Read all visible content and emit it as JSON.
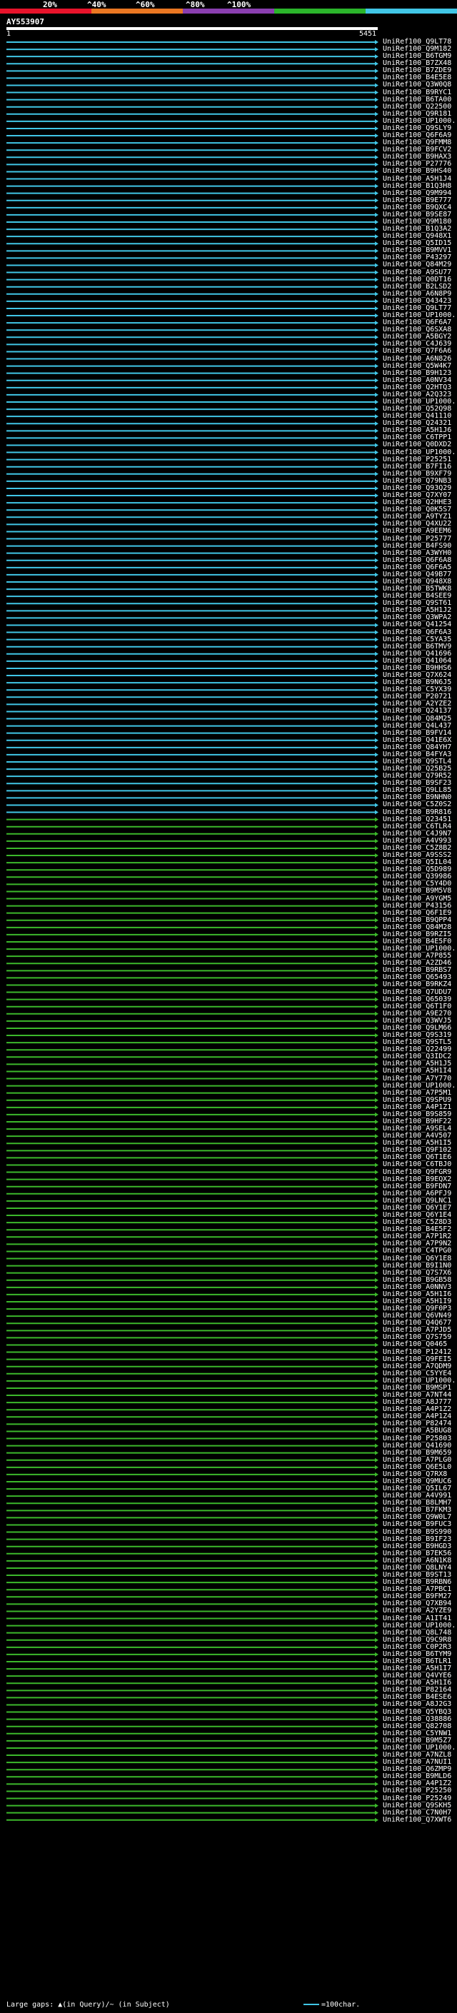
{
  "scale": {
    "labels": [
      "20%",
      "^40%",
      "^60%",
      "^80%",
      "^100%"
    ],
    "colors": [
      "#e8132b",
      "#ea7722",
      "#8a3fb0",
      "#2bb52b",
      "#41c6e6"
    ]
  },
  "query": {
    "id": "AY553907",
    "start": "1",
    "end": "5451"
  },
  "colors": {
    "high": "#41c6e6",
    "mid": "#3cb82b"
  },
  "hits": [
    "UniRef100_Q9LT78",
    "UniRef100_Q9M182",
    "UniRef100_B6TGM9",
    "UniRef100_B7ZX48",
    "UniRef100_B7ZDE9",
    "UniRef100_B4E5E8",
    "UniRef100_Q3W0Q8",
    "UniRef100_B9RYC1",
    "UniRef100_B6TA00",
    "UniRef100_Q22500",
    "UniRef100_Q9R181",
    "UniRef100_UP1000...",
    "UniRef100_Q9SLY9",
    "UniRef100_Q6F6A9",
    "UniRef100_Q9FMM8",
    "UniRef100_B9FCV2",
    "UniRef100_B9HAX3",
    "UniRef100_P27776",
    "UniRef100_B9HS40",
    "UniRef100_A5H1J4",
    "UniRef100_B1Q3H8",
    "UniRef100_Q9M994",
    "UniRef100_B9E777",
    "UniRef100_B9QXC4",
    "UniRef100_B9SE87",
    "UniRef100_Q9M180",
    "UniRef100_B1Q3A2",
    "UniRef100_Q948X1",
    "UniRef100_Q5ID15",
    "UniRef100_B9MVV1",
    "UniRef100_P43297",
    "UniRef100_Q84M29",
    "UniRef100_A9SU77",
    "UniRef100_Q0DT16",
    "UniRef100_B2LSD2",
    "UniRef100_A6N8P9",
    "UniRef100_Q43423",
    "UniRef100_Q9LT77",
    "UniRef100_UP1000...",
    "UniRef100_Q6F6A7",
    "UniRef100_Q6SXA8",
    "UniRef100_A5BGY2",
    "UniRef100_C4J639",
    "UniRef100_Q7F6A6",
    "UniRef100_A6N826",
    "UniRef100_Q5W4K7",
    "UniRef100_B9H123",
    "UniRef100_A0NV34",
    "UniRef100_Q2HTQ3",
    "UniRef100_A2Q323",
    "UniRef100_UP1000...",
    "UniRef100_Q52Q98",
    "UniRef100_Q41110",
    "UniRef100_Q24321",
    "UniRef100_A5H1J6",
    "UniRef100_C6TPP1",
    "UniRef100_Q0DXD2",
    "UniRef100_UP1000...",
    "UniRef100_P25251",
    "UniRef100_B7FI16",
    "UniRef100_B9XF79",
    "UniRef100_Q79NB3",
    "UniRef100_Q93Q29",
    "UniRef100_Q7XY07",
    "UniRef100_Q2HHE3",
    "UniRef100_Q0K5S7",
    "UniRef100_A9TYZ1",
    "UniRef100_Q4XU22",
    "UniRef100_A9EEM6",
    "UniRef100_P25777",
    "UniRef100_B4FS90",
    "UniRef100_A3WYH0",
    "UniRef100_Q6F6A8",
    "UniRef100_Q6F6A5",
    "UniRef100_Q49B77",
    "UniRef100_Q948X8",
    "UniRef100_B5TWK8",
    "UniRef100_B4SEE9",
    "UniRef100_Q9ST61",
    "UniRef100_A5H1J2",
    "UniRef100_Q3WPA2",
    "UniRef100_Q41254",
    "UniRef100_Q6F6A3",
    "UniRef100_C5YA35",
    "UniRef100_B6TMV9",
    "UniRef100_Q41696",
    "UniRef100_Q41064",
    "UniRef100_B9HHS6",
    "UniRef100_Q7X624",
    "UniRef100_B9N6J5",
    "UniRef100_C5YX39",
    "UniRef100_P20721",
    "UniRef100_A2YZE2",
    "UniRef100_Q24137",
    "UniRef100_Q84M25",
    "UniRef100_Q4L437",
    "UniRef100_B9FV14",
    "UniRef100_Q41E6X",
    "UniRef100_Q84YH7",
    "UniRef100_B4FYA3",
    "UniRef100_Q9STL4",
    "UniRef100_Q25B25",
    "UniRef100_Q79R52",
    "UniRef100_B9SF23",
    "UniRef100_Q9LL85",
    "UniRef100_B9NHN0",
    "UniRef100_C5Z0S2",
    "UniRef100_B9R816",
    "UniRef100_Q23451",
    "UniRef100_C6TLR4",
    "UniRef100_C4J9N7",
    "UniRef100_A4V993",
    "UniRef100_C5Z8B2",
    "UniRef100_A9SSS2",
    "UniRef100_Q5IL04",
    "UniRef100_Q5D989",
    "UniRef100_Q39986",
    "UniRef100_C5Y4D0",
    "UniRef100_B9M5V8",
    "UniRef100_A9YGM5",
    "UniRef100_P43156",
    "UniRef100_Q6F1E9",
    "UniRef100_B9QPP4",
    "UniRef100_Q84M28",
    "UniRef100_B9RZI5",
    "UniRef100_B4E5F0",
    "UniRef100_UP1000...",
    "UniRef100_A7P855",
    "UniRef100_A2ZD46",
    "UniRef100_B9RBS7",
    "UniRef100_Q65493",
    "UniRef100_B9RKZ4",
    "UniRef100_Q7UDU7",
    "UniRef100_Q65039",
    "UniRef100_Q6T1F0",
    "UniRef100_A9E270",
    "UniRef100_Q3WVJ5",
    "UniRef100_Q9LM66",
    "UniRef100_Q9S319",
    "UniRef100_Q9STL5",
    "UniRef100_Q22499",
    "UniRef100_Q3IDC2",
    "UniRef100_A5H1J5",
    "UniRef100_A5H1I4",
    "UniRef100_A7Y770",
    "UniRef100_UP1000...",
    "UniRef100_A7P5M1",
    "UniRef100_Q9SPU9",
    "UniRef100_A4P1Z1",
    "UniRef100_B9S859",
    "UniRef100_B9HF22",
    "UniRef100_A9SEL4",
    "UniRef100_A4V507",
    "UniRef100_A5H1I5",
    "UniRef100_Q9F102",
    "UniRef100_Q6T1E6",
    "UniRef100_C6TBJ0",
    "UniRef100_Q9FGR9",
    "UniRef100_B9EQX2",
    "UniRef100_B9FDN7",
    "UniRef100_A6PFJ9",
    "UniRef100_Q9LNC1",
    "UniRef100_Q6Y1E7",
    "UniRef100_Q6Y1E4",
    "UniRef100_C5Z8D3",
    "UniRef100_B4E5F2",
    "UniRef100_A7P1R2",
    "UniRef100_A7P9N2",
    "UniRef100_C4TPG0",
    "UniRef100_Q6Y1E8",
    "UniRef100_B9I1N0",
    "UniRef100_Q7S7X6",
    "UniRef100_B9GB58",
    "UniRef100_A0NNV3",
    "UniRef100_A5H1I6",
    "UniRef100_A5H1I9",
    "UniRef100_Q9F0P3",
    "UniRef100_Q6VN49",
    "UniRef100_Q4Q677",
    "UniRef100_A7PJD5",
    "UniRef100_Q7S759",
    "UniRef100_Q0465",
    "UniRef100_P12412",
    "UniRef100_Q9FEI5",
    "UniRef100_A7QDM9",
    "UniRef100_C5YYE4",
    "UniRef100_UP1000...",
    "UniRef100_B9MSP1",
    "UniRef100_A7NT44",
    "UniRef100_A8J777",
    "UniRef100_A4P1Z2",
    "UniRef100_A4P1Z4",
    "UniRef100_P82474",
    "UniRef100_A5BUG8",
    "UniRef100_P25803",
    "UniRef100_Q41690",
    "UniRef100_B9M659",
    "UniRef100_A7PLG0",
    "UniRef100_Q6E5L0",
    "UniRef100_Q7RX8",
    "UniRef100_Q9MUC6",
    "UniRef100_Q5IL67",
    "UniRef100_A4V991",
    "UniRef100_B8LMH7",
    "UniRef100_B7FKM3",
    "UniRef100_Q9W0L7",
    "UniRef100_B9FUC3",
    "UniRef100_B9S990",
    "UniRef100_B9IF23",
    "UniRef100_B9HGD3",
    "UniRef100_B7EK56",
    "UniRef100_A6N1K8",
    "UniRef100_Q8LNY4",
    "UniRef100_B9ST13",
    "UniRef100_B9RBN6",
    "UniRef100_A7PBC1",
    "UniRef100_B9FM27",
    "UniRef100_Q7XB94",
    "UniRef100_A2YZE9",
    "UniRef100_A1IT41",
    "UniRef100_UP1000...",
    "UniRef100_Q8L748",
    "UniRef100_Q9C9R8",
    "UniRef100_C0P2R3",
    "UniRef100_B6TYM9",
    "UniRef100_B6TLR1",
    "UniRef100_A5H1I7",
    "UniRef100_Q4VYE6",
    "UniRef100_A5H1I6",
    "UniRef100_P82164",
    "UniRef100_B4ESE6",
    "UniRef100_A8J2G3",
    "UniRef100_Q5YBQ3",
    "UniRef100_Q38886",
    "UniRef100_Q82708",
    "UniRef100_C5YNW1",
    "UniRef100_B9M5Z7",
    "UniRef100_UP1000...",
    "UniRef100_A7NZL8",
    "UniRef100_A7NUI1",
    "UniRef100_Q6ZMP9",
    "UniRef100_B9MLD6",
    "UniRef100_A4P1Z2",
    "UniRef100_P25250",
    "UniRef100_P25249",
    "UniRef100_Q9SKH5",
    "UniRef100_C7N0H7",
    "UniRef100_Q7XWT6"
  ],
  "footer": {
    "text": "Large gaps: ▲(in Query)/~ (in Subject)",
    "legend": "=100char."
  }
}
